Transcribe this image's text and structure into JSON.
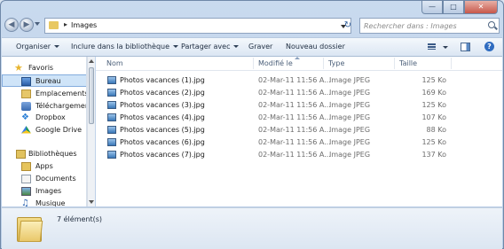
{
  "address": {
    "crumb": "Images"
  },
  "search": {
    "placeholder": "Rechercher dans : Images"
  },
  "toolbar": {
    "organize": "Organiser",
    "include": "Inclure dans la bibliothèque",
    "share": "Partager avec",
    "burn": "Graver",
    "new_folder": "Nouveau dossier"
  },
  "nav": {
    "favorites": "Favoris",
    "items": [
      {
        "label": "Bureau",
        "icon": "desktop-icon"
      },
      {
        "label": "Emplacements re",
        "icon": "recent-places-icon"
      },
      {
        "label": "Téléchargement",
        "icon": "downloads-icon"
      },
      {
        "label": "Dropbox",
        "icon": "dropbox-icon"
      },
      {
        "label": "Google Drive",
        "icon": "google-drive-icon"
      }
    ],
    "libraries": "Bibliothèques",
    "lib_items": [
      {
        "label": "Apps",
        "icon": "folder-icon"
      },
      {
        "label": "Documents",
        "icon": "documents-icon"
      },
      {
        "label": "Images",
        "icon": "pictures-icon"
      },
      {
        "label": "Musique",
        "icon": "music-icon"
      }
    ]
  },
  "columns": {
    "name": "Nom",
    "modified": "Modifié le",
    "type": "Type",
    "size": "Taille"
  },
  "files": [
    {
      "name": "Photos vacances (1).jpg",
      "date": "02-Mar-11 11:56 A...",
      "type": "Image JPEG",
      "size": "125 Ko"
    },
    {
      "name": "Photos vacances (2).jpg",
      "date": "02-Mar-11 11:56 A...",
      "type": "Image JPEG",
      "size": "169 Ko"
    },
    {
      "name": "Photos vacances (3).jpg",
      "date": "02-Mar-11 11:56 A...",
      "type": "Image JPEG",
      "size": "125 Ko"
    },
    {
      "name": "Photos vacances (4).jpg",
      "date": "02-Mar-11 11:56 A...",
      "type": "Image JPEG",
      "size": "107 Ko"
    },
    {
      "name": "Photos vacances (5).jpg",
      "date": "02-Mar-11 11:56 A...",
      "type": "Image JPEG",
      "size": "88 Ko"
    },
    {
      "name": "Photos vacances (6).jpg",
      "date": "02-Mar-11 11:56 A...",
      "type": "Image JPEG",
      "size": "125 Ko"
    },
    {
      "name": "Photos vacances (7).jpg",
      "date": "02-Mar-11 11:56 A...",
      "type": "Image JPEG",
      "size": "137 Ko"
    }
  ],
  "status": {
    "count": "7 élément(s)"
  }
}
